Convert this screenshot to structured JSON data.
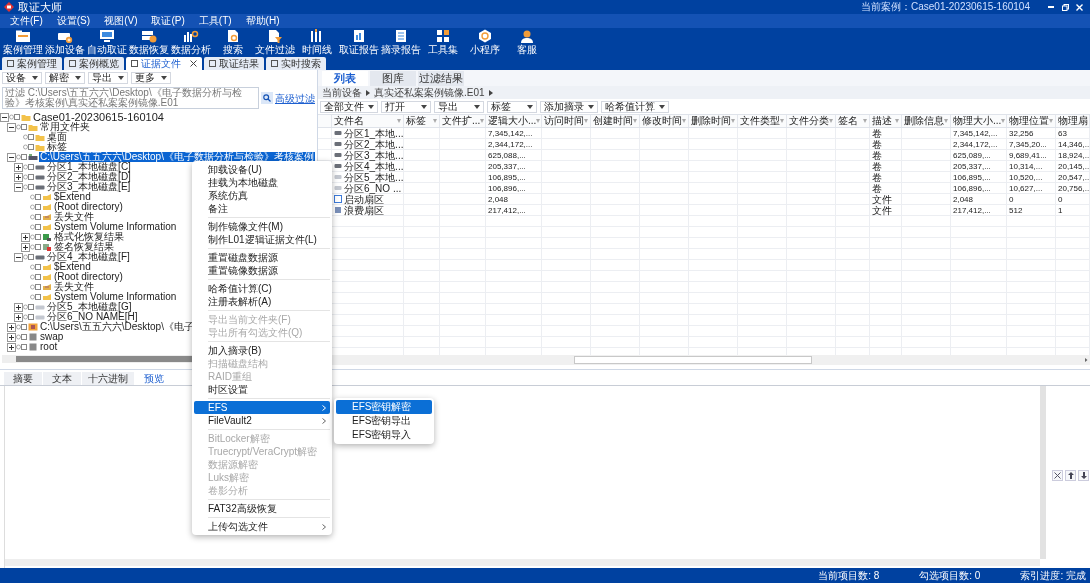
{
  "window": {
    "title": "取证大师",
    "current_case": "当前案例：Case01-20230615-160104"
  },
  "menu_bar": [
    "文件(F)",
    "设置(S)",
    "视图(V)",
    "取证(P)",
    "工具(T)",
    "帮助(H)"
  ],
  "toolbar": [
    "案例管理",
    "添加设备",
    "自动取证",
    "数据恢复",
    "数据分析",
    "搜索",
    "文件过滤",
    "时间线",
    "取证报告",
    "摘录报告",
    "工具集",
    "小程序",
    "客服"
  ],
  "tabs": [
    {
      "label": "案例管理",
      "selected": false,
      "closable": false
    },
    {
      "label": "案例概览",
      "selected": false,
      "closable": false
    },
    {
      "label": "证据文件",
      "selected": true,
      "closable": true
    },
    {
      "label": "取证结果",
      "selected": false,
      "closable": false
    },
    {
      "label": "实时搜索",
      "selected": false,
      "closable": false
    }
  ],
  "left_panel": {
    "toolbar": [
      "设备",
      "解密",
      "导出",
      "更多"
    ],
    "filter": {
      "placeholder": "过滤 C:\\Users\\五五六六\\Desktop\\《电子数据分析与检验》考核案例\\真实还私案案例镜像.E01",
      "advanced_link": "高级过滤"
    },
    "tree": [
      {
        "label": "Case01-20230615-160104",
        "kind": "case",
        "expanded": true,
        "selected": false,
        "checked": false,
        "children": [
          {
            "label": "常用文件夹",
            "kind": "folder",
            "expanded": true,
            "selected": false,
            "checked": false,
            "children": [
              {
                "label": "桌面",
                "kind": "folder",
                "selected": false,
                "checked": false
              },
              {
                "label": "标签",
                "kind": "folder",
                "selected": false,
                "checked": false
              }
            ]
          },
          {
            "label": "C:\\Users\\五五六六\\Desktop\\《电子数据分析与检验》考核案例",
            "kind": "device",
            "expanded": true,
            "selected": true,
            "checked": false,
            "children": [
              {
                "label": "分区1_本地磁盘[C]",
                "kind": "disk",
                "expanded": false,
                "selected": false,
                "checked": false
              },
              {
                "label": "分区2_本地磁盘[D]",
                "kind": "disk",
                "expanded": false,
                "selected": false,
                "checked": false
              },
              {
                "label": "分区3_本地磁盘[E]",
                "kind": "disk",
                "expanded": true,
                "selected": false,
                "checked": false,
                "children": [
                  {
                    "label": "$Extend",
                    "kind": "system_folder",
                    "selected": false,
                    "checked": false
                  },
                  {
                    "label": "(Root directory)",
                    "kind": "system_folder",
                    "selected": false,
                    "checked": false
                  },
                  {
                    "label": "丢失文件",
                    "kind": "lost",
                    "selected": false,
                    "checked": false
                  },
                  {
                    "label": "System Volume Information",
                    "kind": "system_folder",
                    "selected": false,
                    "checked": false
                  },
                  {
                    "label": "格式化恢复结果",
                    "kind": "format_result",
                    "expanded": false,
                    "selected": false,
                    "checked": false
                  },
                  {
                    "label": "签名恢复结果",
                    "kind": "signature_result",
                    "expanded": false,
                    "selected": false,
                    "checked": false
                  }
                ]
              },
              {
                "label": "分区4_本地磁盘[F]",
                "kind": "disk",
                "expanded": true,
                "selected": false,
                "checked": false,
                "children": [
                  {
                    "label": "$Extend",
                    "kind": "system_folder",
                    "selected": false,
                    "checked": false
                  },
                  {
                    "label": "(Root directory)",
                    "kind": "system_folder",
                    "selected": false,
                    "checked": false
                  },
                  {
                    "label": "丢失文件",
                    "kind": "lost",
                    "selected": false,
                    "checked": false
                  },
                  {
                    "label": "System Volume Information",
                    "kind": "system_folder",
                    "selected": false,
                    "checked": false
                  }
                ]
              },
              {
                "label": "分区5_本地磁盘[G]",
                "kind": "disk_empty",
                "expanded": false,
                "selected": false,
                "checked": false
              },
              {
                "label": "分区6_NO NAME[H]",
                "kind": "disk_empty",
                "expanded": false,
                "selected": false,
                "checked": false
              }
            ]
          },
          {
            "label": "C:\\Users\\五五六六\\Desktop\\《电子",
            "kind": "image",
            "expanded": false,
            "selected": false,
            "checked": false
          },
          {
            "label": "swap",
            "kind": "volume",
            "expanded": false,
            "selected": false,
            "checked": false
          },
          {
            "label": "root",
            "kind": "volume",
            "expanded": false,
            "selected": false,
            "checked": false
          }
        ]
      }
    ]
  },
  "right_panel": {
    "tabs": [
      {
        "label": "列表",
        "selected": true
      },
      {
        "label": "图库",
        "selected": false
      },
      {
        "label": "过滤结果",
        "selected": false
      }
    ],
    "breadcrumb": [
      "当前设备",
      "真实还私案案例镜像.E01"
    ],
    "toolbar": [
      "全部文件",
      "打开",
      "导出",
      "标签",
      "添加摘录",
      "哈希值计算"
    ],
    "table": {
      "columns": [
        {
          "label": "文件名",
          "filter": true
        },
        {
          "label": "标签",
          "filter": true
        },
        {
          "label": "文件扩...",
          "filter": true
        },
        {
          "label": "逻辑大小...",
          "filter": true
        },
        {
          "label": "访问时间",
          "filter": true
        },
        {
          "label": "创建时间",
          "filter": true
        },
        {
          "label": "修改时间",
          "filter": true
        },
        {
          "label": "删除时间",
          "filter": true
        },
        {
          "label": "文件类型",
          "filter": true
        },
        {
          "label": "文件分类",
          "filter": true
        },
        {
          "label": "签名",
          "filter": true
        },
        {
          "label": "描述",
          "filter": true
        },
        {
          "label": "删除信息",
          "filter": true
        },
        {
          "label": "物理大小...",
          "filter": true
        },
        {
          "label": "物理位置",
          "filter": true
        },
        {
          "label": "物理扇"
        }
      ],
      "rows": [
        {
          "kind": "partition",
          "selected": false,
          "file_name": "分区1_本地...",
          "logical_size": "7,345,142,...",
          "description": "卷",
          "physical_size": "7,345,142,...",
          "physical_location": "32,256",
          "physical_sector": "63"
        },
        {
          "kind": "partition",
          "selected": false,
          "file_name": "分区2_本地...",
          "logical_size": "2,344,172,...",
          "description": "卷",
          "physical_size": "2,344,172,...",
          "physical_location": "7,345,20...",
          "physical_sector": "14,346,..."
        },
        {
          "kind": "partition",
          "selected": false,
          "file_name": "分区3_本地...",
          "logical_size": "625,088,...",
          "description": "卷",
          "physical_size": "625,089,...",
          "physical_location": "9,689,41...",
          "physical_sector": "18,924,..."
        },
        {
          "kind": "partition",
          "selected": false,
          "file_name": "分区4_本地...",
          "logical_size": "205,337,...",
          "description": "卷",
          "physical_size": "205,337,...",
          "physical_location": "10,314,...",
          "physical_sector": "20,145,..."
        },
        {
          "kind": "partition_empty",
          "selected": false,
          "file_name": "分区5_本地...",
          "logical_size": "106,895,...",
          "description": "卷",
          "physical_size": "106,895,...",
          "physical_location": "10,520,...",
          "physical_sector": "20,547,..."
        },
        {
          "kind": "partition_empty",
          "selected": false,
          "file_name": "分区6_NO ...",
          "logical_size": "106,896,...",
          "description": "卷",
          "physical_size": "106,896,...",
          "physical_location": "10,627,...",
          "physical_sector": "20,756,..."
        },
        {
          "kind": "boot",
          "selected": false,
          "file_name": "启动扇区",
          "logical_size": "2,048",
          "description": "文件",
          "physical_size": "2,048",
          "physical_location": "0",
          "physical_sector": "0"
        },
        {
          "kind": "sector",
          "selected": false,
          "file_name": "浪费扇区",
          "logical_size": "217,412,...",
          "description": "文件",
          "physical_size": "217,412,...",
          "physical_location": "512",
          "physical_sector": "1"
        }
      ]
    }
  },
  "bottom_panel": {
    "tabs": [
      {
        "label": "摘要",
        "selected": false
      },
      {
        "label": "文本",
        "selected": false
      },
      {
        "label": "十六进制",
        "selected": false
      },
      {
        "label": "预览",
        "selected": true
      }
    ]
  },
  "context_menu": {
    "items": [
      {
        "kind": "item",
        "label": "卸载设备(U)",
        "disabled": false,
        "selected": false,
        "submenu": false
      },
      {
        "kind": "item",
        "label": "挂载为本地磁盘",
        "disabled": false,
        "selected": false,
        "submenu": false
      },
      {
        "kind": "item",
        "label": "系统仿真",
        "disabled": false,
        "selected": false,
        "submenu": false
      },
      {
        "kind": "item",
        "label": "备注",
        "disabled": false,
        "selected": false,
        "submenu": false
      },
      {
        "kind": "separator"
      },
      {
        "kind": "item",
        "label": "制作镜像文件(M)",
        "disabled": false,
        "selected": false,
        "submenu": false
      },
      {
        "kind": "item",
        "label": "制作L01逻辑证据文件(L)",
        "disabled": false,
        "selected": false,
        "submenu": false
      },
      {
        "kind": "separator"
      },
      {
        "kind": "item",
        "label": "重置磁盘数据源",
        "disabled": false,
        "selected": false,
        "submenu": false
      },
      {
        "kind": "item",
        "label": "重置镜像数据源",
        "disabled": false,
        "selected": false,
        "submenu": false
      },
      {
        "kind": "separator"
      },
      {
        "kind": "item",
        "label": "哈希值计算(C)",
        "disabled": false,
        "selected": false,
        "submenu": false
      },
      {
        "kind": "item",
        "label": "注册表解析(A)",
        "disabled": false,
        "selected": false,
        "submenu": false
      },
      {
        "kind": "separator"
      },
      {
        "kind": "item",
        "label": "导出当前文件夹(F)",
        "disabled": true,
        "selected": false,
        "submenu": false
      },
      {
        "kind": "item",
        "label": "导出所有勾选文件(Q)",
        "disabled": true,
        "selected": false,
        "submenu": false
      },
      {
        "kind": "separator"
      },
      {
        "kind": "item",
        "label": "加入摘录(B)",
        "disabled": false,
        "selected": false,
        "submenu": false
      },
      {
        "kind": "item",
        "label": "扫描磁盘结构",
        "disabled": true,
        "selected": false,
        "submenu": false
      },
      {
        "kind": "item",
        "label": "RAID重组",
        "disabled": true,
        "selected": false,
        "submenu": false
      },
      {
        "kind": "item",
        "label": "时区设置",
        "disabled": false,
        "selected": false,
        "submenu": false
      },
      {
        "kind": "separator"
      },
      {
        "kind": "item",
        "label": "EFS",
        "disabled": false,
        "selected": true,
        "submenu": true,
        "children": [
          {
            "label": "EFS密钥解密",
            "selected": true
          },
          {
            "label": "EFS密钥导出",
            "selected": false
          },
          {
            "label": "EFS密钥导入",
            "selected": false
          }
        ]
      },
      {
        "kind": "item",
        "label": "FileVault2",
        "disabled": false,
        "selected": false,
        "submenu": true
      },
      {
        "kind": "separator"
      },
      {
        "kind": "item",
        "label": "BitLocker解密",
        "disabled": true,
        "selected": false,
        "submenu": false
      },
      {
        "kind": "item",
        "label": "Truecrypt/VeraCrypt解密",
        "disabled": true,
        "selected": false,
        "submenu": false
      },
      {
        "kind": "item",
        "label": "数据源解密",
        "disabled": true,
        "selected": false,
        "submenu": false
      },
      {
        "kind": "item",
        "label": "Luks解密",
        "disabled": true,
        "selected": false,
        "submenu": false
      },
      {
        "kind": "item",
        "label": "卷影分析",
        "disabled": true,
        "selected": false,
        "submenu": false
      },
      {
        "kind": "separator"
      },
      {
        "kind": "item",
        "label": "FAT32高级恢复",
        "disabled": false,
        "selected": false,
        "submenu": false
      },
      {
        "kind": "separator"
      },
      {
        "kind": "item",
        "label": "上传勾选文件",
        "disabled": false,
        "selected": false,
        "submenu": true
      }
    ]
  },
  "status_bar": [
    "当前项目数: 8",
    "勾选项目数: 0",
    "索引进度: 完成"
  ]
}
